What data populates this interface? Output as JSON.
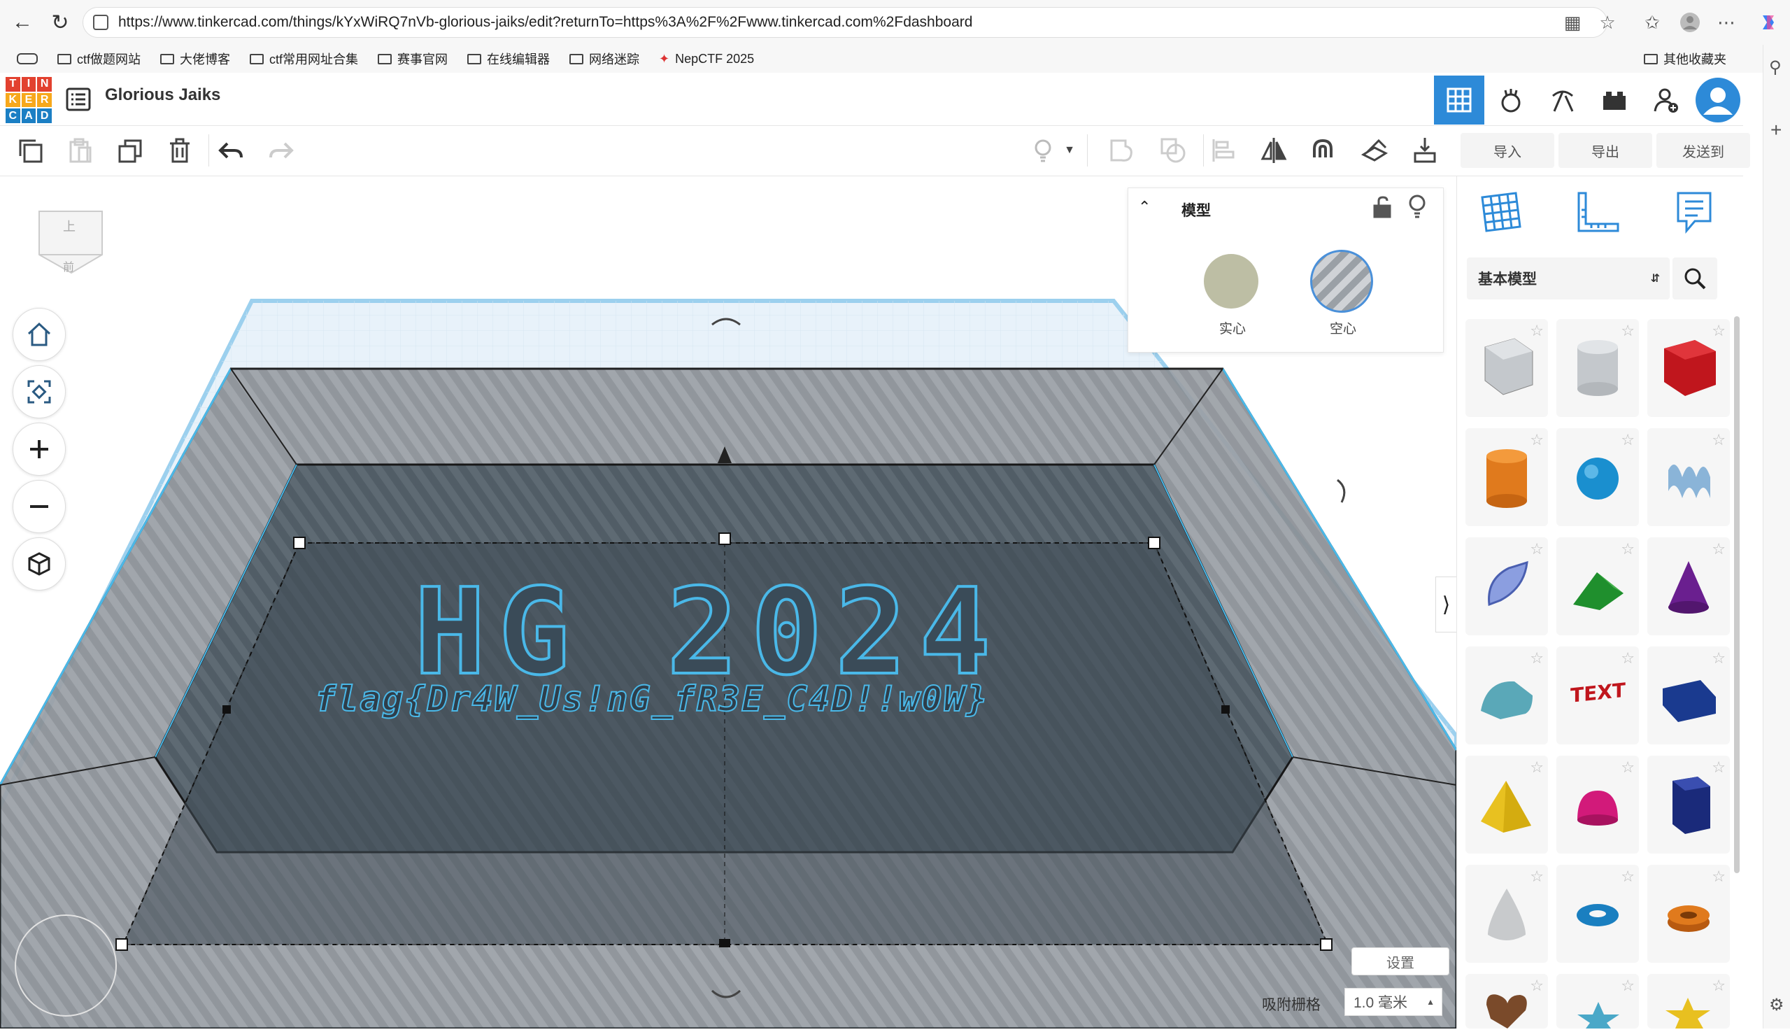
{
  "browser": {
    "url": "https://www.tinkercad.com/things/kYxWiRQ7nVb-glorious-jaiks/edit?returnTo=https%3A%2F%2Fwww.tinkercad.com%2Fdashboard",
    "bookmarks": [
      "ctf做题网站",
      "大佬博客",
      "ctf常用网址合集",
      "赛事官网",
      "在线编辑器",
      "网络迷踪",
      "NepCTF 2025"
    ],
    "other_bookmarks": "其他收藏夹"
  },
  "app": {
    "logo_letters": [
      "TIN",
      "KER",
      "CAD"
    ],
    "logo_cells": [
      "T",
      "I",
      "N",
      "K",
      "E",
      "R",
      "C",
      "A",
      "D"
    ],
    "logo_colors": [
      "#e2412f",
      "#e2412f",
      "#e2412f",
      "#f7a81b",
      "#f7a81b",
      "#f7a81b",
      "#1b7fc4",
      "#1b7fc4",
      "#1b7fc4"
    ],
    "design_title": "Glorious Jaiks"
  },
  "toolbar": {
    "import": "导入",
    "export": "导出",
    "send_to": "发送到"
  },
  "viewcube": {
    "top": "上",
    "front": "前"
  },
  "inspector": {
    "title": "模型",
    "solid_label": "实心",
    "hole_label": "空心",
    "solid_color": "#bdbea4"
  },
  "scene": {
    "line1": "HG 2024",
    "line2": "flag{Dr4W_Us!nG_fR3E_C4D!!w0W}"
  },
  "bottom": {
    "settings": "设置",
    "snap_label": "吸附栅格",
    "snap_value": "1.0 毫米"
  },
  "shapes": {
    "category": "基本模型"
  },
  "colors": {
    "accent": "#1b7fc4",
    "active_tab": "#2d8ad8"
  }
}
